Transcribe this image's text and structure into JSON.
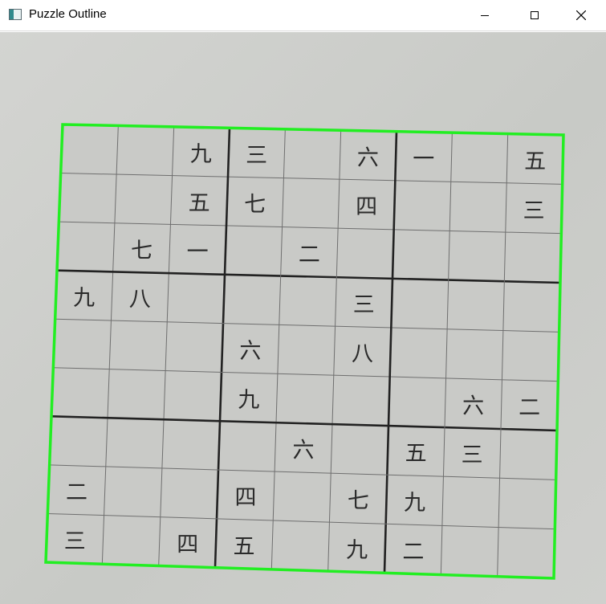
{
  "window": {
    "title": "Puzzle Outline",
    "icon": "app-window-icon",
    "controls": [
      "minimize-icon",
      "maximize-icon",
      "close-icon"
    ]
  },
  "puzzle": {
    "outline_color": "#22ee22",
    "grid": [
      [
        "",
        "",
        "九",
        "三",
        "",
        "六",
        "一",
        "",
        "五"
      ],
      [
        "",
        "",
        "五",
        "七",
        "",
        "四",
        "",
        "",
        "三"
      ],
      [
        "",
        "七",
        "一",
        "",
        "二",
        "",
        "",
        "",
        ""
      ],
      [
        "九",
        "八",
        "",
        "",
        "",
        "三",
        "",
        "",
        ""
      ],
      [
        "",
        "",
        "",
        "六",
        "",
        "八",
        "",
        "",
        ""
      ],
      [
        "",
        "",
        "",
        "九",
        "",
        "",
        "",
        "六",
        "二"
      ],
      [
        "",
        "",
        "",
        "",
        "六",
        "",
        "五",
        "三",
        ""
      ],
      [
        "二",
        "",
        "",
        "四",
        "",
        "七",
        "九",
        "",
        ""
      ],
      [
        "三",
        "",
        "四",
        "五",
        "",
        "九",
        "二",
        "",
        ""
      ]
    ]
  }
}
